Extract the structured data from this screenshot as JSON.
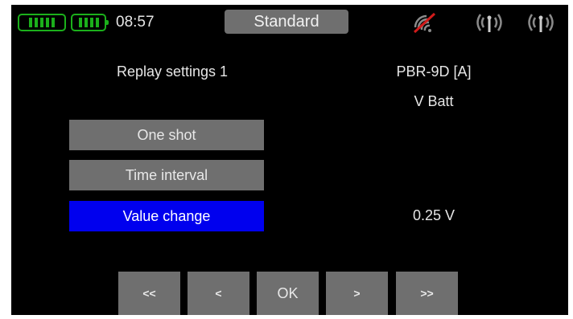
{
  "status_bar": {
    "time": "08:57",
    "model_name": "Standard",
    "battery_color": "#1bb01b",
    "icons": [
      "battery-icon",
      "battery-icon",
      "wifi-off-icon",
      "antenna-icon",
      "antenna-icon"
    ]
  },
  "screen": {
    "title": "Replay settings 1",
    "sensor_name": "PBR-9D [A]",
    "sensor_value_name": "V Batt",
    "change_value": "0.25 V"
  },
  "modes": [
    {
      "label": "One shot",
      "selected": false
    },
    {
      "label": "Time interval",
      "selected": false
    },
    {
      "label": "Value change",
      "selected": true
    }
  ],
  "nav": {
    "first": "<<",
    "prev": "<",
    "ok": "OK",
    "next": ">",
    "last": ">>"
  },
  "colors": {
    "background": "#000000",
    "button": "#6f6f6f",
    "selected": "#0000ee",
    "text": "#e6e6e6"
  }
}
